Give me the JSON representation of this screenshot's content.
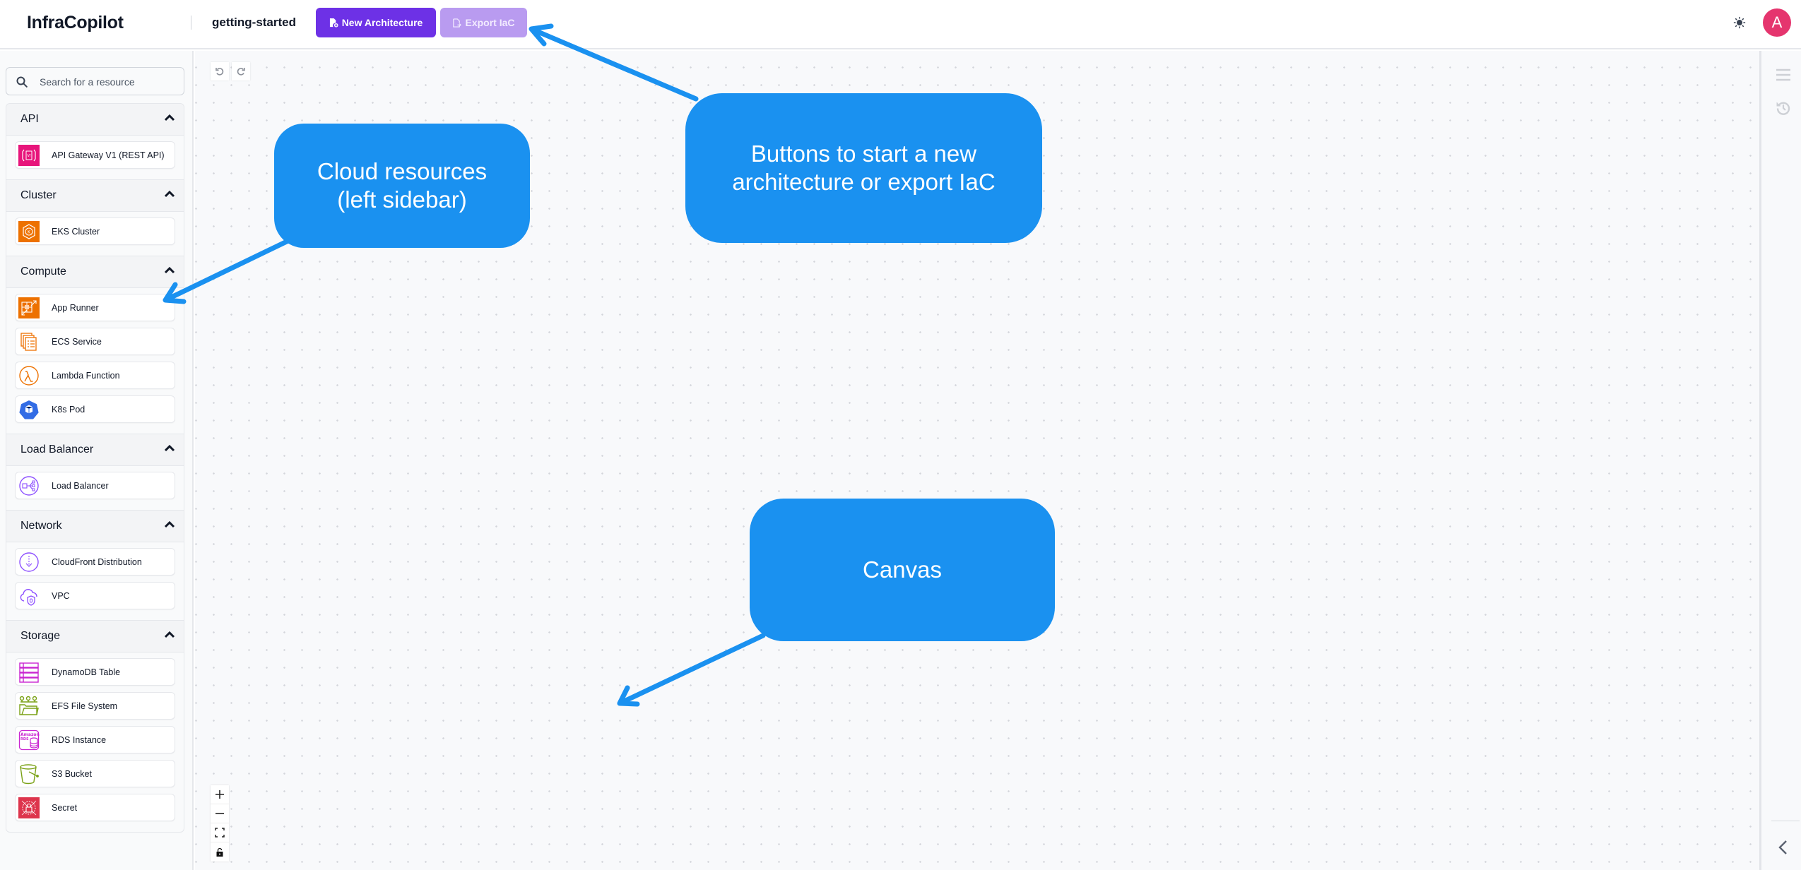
{
  "header": {
    "app_name": "InfraCopilot",
    "project_name": "getting-started",
    "new_architecture_label": "New Architecture",
    "export_iac_label": "Export IaC",
    "theme_toggle_icon": "sun-icon",
    "avatar_initial": "A",
    "colors": {
      "primary": "#6d31e6",
      "primary_disabled": "#b99bf0",
      "avatar": "#e5356e"
    }
  },
  "sidebar": {
    "search_placeholder": "Search for a resource",
    "sections": [
      {
        "title": "API",
        "expanded": true,
        "items": [
          {
            "label": "API Gateway V1 (REST API)",
            "icon": "api-gateway-icon"
          }
        ]
      },
      {
        "title": "Cluster",
        "expanded": true,
        "items": [
          {
            "label": "EKS Cluster",
            "icon": "eks-cluster-icon"
          }
        ]
      },
      {
        "title": "Compute",
        "expanded": true,
        "items": [
          {
            "label": "App Runner",
            "icon": "app-runner-icon"
          },
          {
            "label": "ECS Service",
            "icon": "ecs-service-icon"
          },
          {
            "label": "Lambda Function",
            "icon": "lambda-icon"
          },
          {
            "label": "K8s Pod",
            "icon": "k8s-pod-icon"
          }
        ]
      },
      {
        "title": "Load Balancer",
        "expanded": true,
        "items": [
          {
            "label": "Load Balancer",
            "icon": "load-balancer-icon"
          }
        ]
      },
      {
        "title": "Network",
        "expanded": true,
        "items": [
          {
            "label": "CloudFront Distribution",
            "icon": "cloudfront-icon"
          },
          {
            "label": "VPC",
            "icon": "vpc-icon"
          }
        ]
      },
      {
        "title": "Storage",
        "expanded": true,
        "items": [
          {
            "label": "DynamoDB Table",
            "icon": "dynamodb-icon"
          },
          {
            "label": "EFS File System",
            "icon": "efs-icon"
          },
          {
            "label": "RDS Instance",
            "icon": "rds-icon"
          },
          {
            "label": "S3 Bucket",
            "icon": "s3-bucket-icon"
          },
          {
            "label": "Secret",
            "icon": "secret-icon"
          }
        ]
      }
    ]
  },
  "canvas": {
    "controls": [
      "undo",
      "redo"
    ],
    "zoom_controls": [
      "zoom-in",
      "zoom-out",
      "fit-view",
      "toggle-lock"
    ]
  },
  "annotations": {
    "color": "#1a91f0",
    "callouts": [
      {
        "id": "sidebar",
        "text_line1": "Cloud resources",
        "text_line2": "(left sidebar)"
      },
      {
        "id": "buttons",
        "text_line1": "Buttons to start a new",
        "text_line2": "architecture or export IaC"
      },
      {
        "id": "canvas",
        "text_line1": "Canvas",
        "text_line2": ""
      }
    ]
  }
}
